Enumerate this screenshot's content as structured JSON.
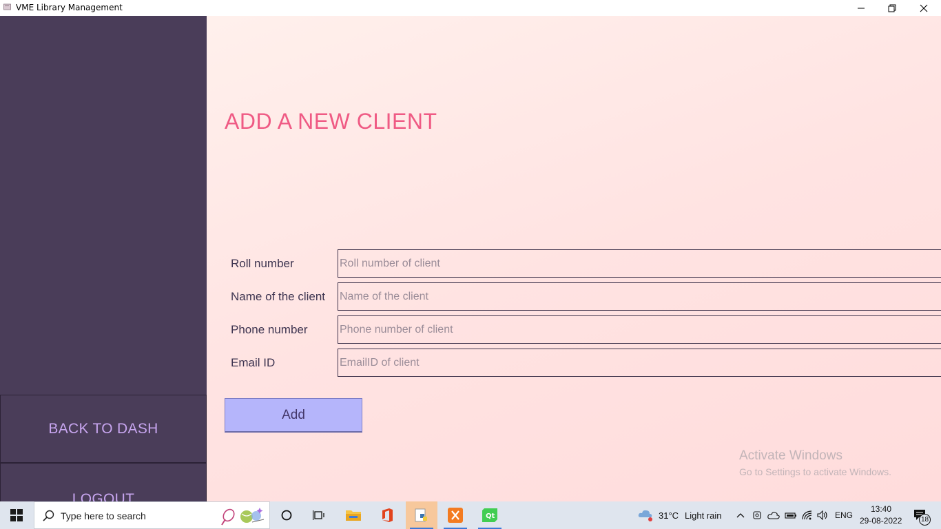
{
  "window": {
    "title": "VME Library Management"
  },
  "sidebar": {
    "back_label": "BACK TO DASH",
    "logout_label": "LOGOUT"
  },
  "main": {
    "title": "ADD A NEW CLIENT",
    "fields": [
      {
        "label": "Roll number",
        "placeholder": "Roll number of client"
      },
      {
        "label": "Name of the client",
        "placeholder": "Name of the client"
      },
      {
        "label": "Phone number",
        "placeholder": "Phone number of client"
      },
      {
        "label": "Email ID",
        "placeholder": "EmailID of client"
      }
    ],
    "add_label": "Add"
  },
  "watermark": {
    "line1": "Activate Windows",
    "line2": "Go to Settings to activate Windows."
  },
  "taskbar": {
    "search_placeholder": "Type here to search",
    "weather_temp": "31°C",
    "weather_desc": "Light rain",
    "language": "ENG",
    "time": "13:40",
    "date": "29-08-2022",
    "notification_count": "18"
  },
  "colors": {
    "sidebar": "#4a3d59",
    "sidebar_text": "#c8a6f0",
    "title": "#ef5a84",
    "add_button": "#b5b5fb"
  }
}
